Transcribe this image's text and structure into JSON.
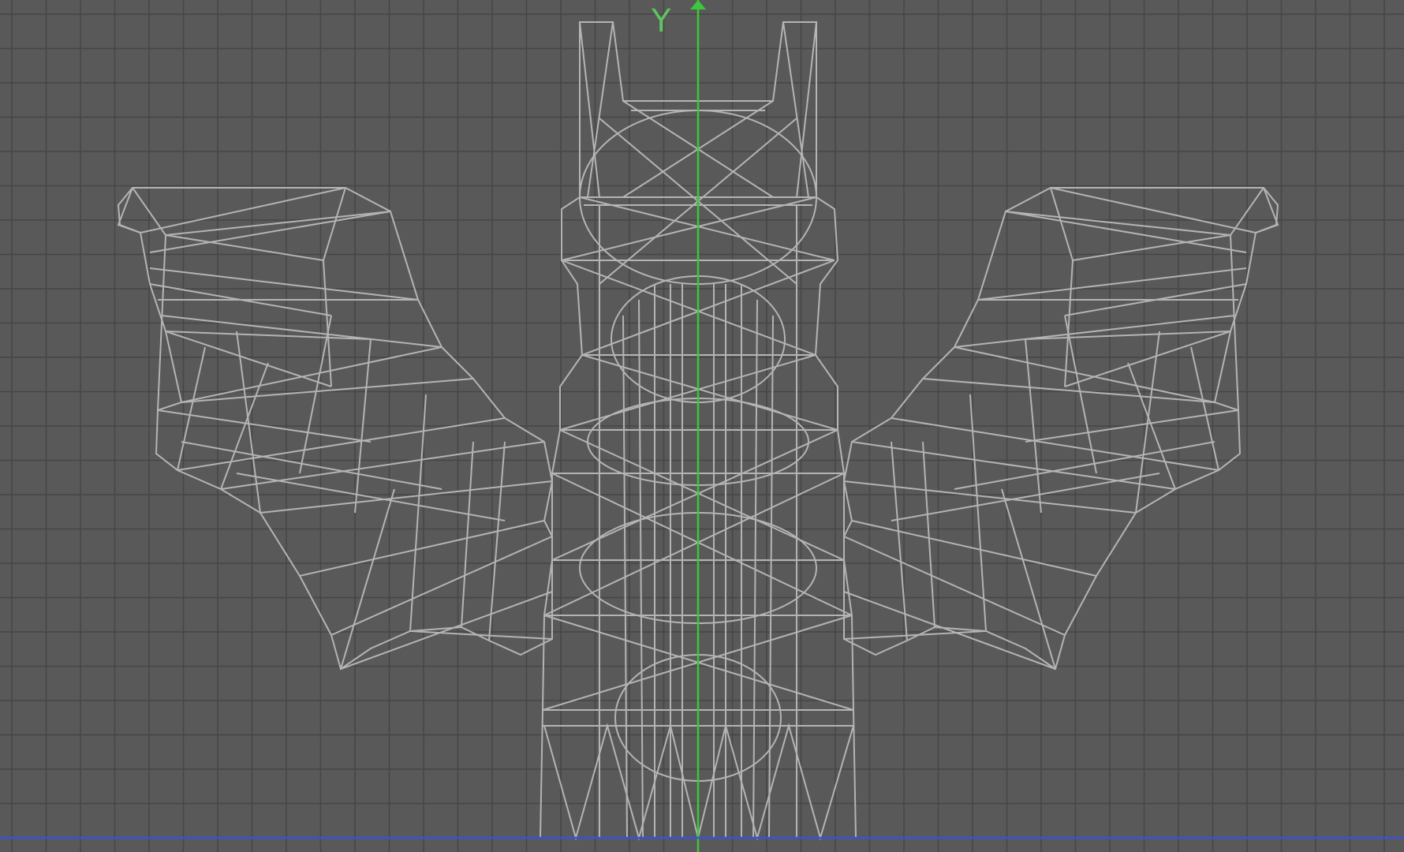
{
  "viewport": {
    "background_color": "#595959",
    "grid_color": "#464646",
    "wire_color": "#b4b4b4",
    "y_axis_color": "#3cc83c",
    "ground_axis_color": "#3c50dc",
    "y_axis_label": "Y"
  },
  "model": {
    "name_icon": "wireframe-bat-mesh"
  }
}
